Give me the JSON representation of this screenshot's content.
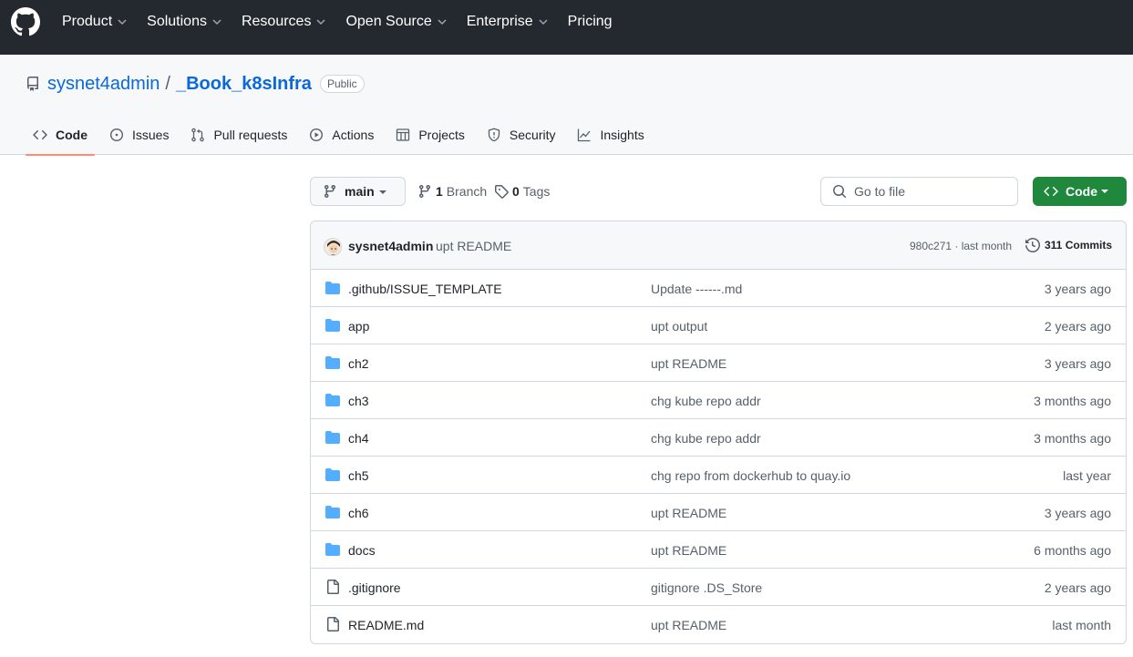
{
  "nav": {
    "items": [
      {
        "label": "Product",
        "dropdown": true
      },
      {
        "label": "Solutions",
        "dropdown": true
      },
      {
        "label": "Resources",
        "dropdown": true
      },
      {
        "label": "Open Source",
        "dropdown": true
      },
      {
        "label": "Enterprise",
        "dropdown": true
      },
      {
        "label": "Pricing",
        "dropdown": false
      }
    ]
  },
  "repo": {
    "owner": "sysnet4admin",
    "separator": "/",
    "name": "_Book_k8sInfra",
    "visibility": "Public"
  },
  "tabs": [
    {
      "label": "Code",
      "icon": "code-icon",
      "active": true
    },
    {
      "label": "Issues",
      "icon": "issue-icon",
      "active": false
    },
    {
      "label": "Pull requests",
      "icon": "pull-request-icon",
      "active": false
    },
    {
      "label": "Actions",
      "icon": "play-icon",
      "active": false
    },
    {
      "label": "Projects",
      "icon": "table-icon",
      "active": false
    },
    {
      "label": "Security",
      "icon": "shield-icon",
      "active": false
    },
    {
      "label": "Insights",
      "icon": "graph-icon",
      "active": false
    }
  ],
  "toolbar": {
    "branch": "main",
    "branch_count": "1",
    "branch_label": "Branch",
    "tag_count": "0",
    "tag_label": "Tags",
    "goto_placeholder": "Go to file",
    "code_label": "Code"
  },
  "latest_commit": {
    "author": "sysnet4admin",
    "message": "upt README",
    "sha_time": "980c271 · last month",
    "commits": "311 Commits"
  },
  "files": [
    {
      "type": "folder",
      "name": ".github/ISSUE_TEMPLATE",
      "message": "Update ------.md",
      "time": "3 years ago"
    },
    {
      "type": "folder",
      "name": "app",
      "message": "upt output",
      "time": "2 years ago"
    },
    {
      "type": "folder",
      "name": "ch2",
      "message": "upt README",
      "time": "3 years ago"
    },
    {
      "type": "folder",
      "name": "ch3",
      "message": "chg kube repo addr",
      "time": "3 months ago"
    },
    {
      "type": "folder",
      "name": "ch4",
      "message": "chg kube repo addr",
      "time": "3 months ago"
    },
    {
      "type": "folder",
      "name": "ch5",
      "message": "chg repo from dockerhub to quay.io",
      "time": "last year"
    },
    {
      "type": "folder",
      "name": "ch6",
      "message": "upt README",
      "time": "3 years ago"
    },
    {
      "type": "folder",
      "name": "docs",
      "message": "upt README",
      "time": "6 months ago"
    },
    {
      "type": "file",
      "name": ".gitignore",
      "message": "gitignore .DS_Store",
      "time": "2 years ago"
    },
    {
      "type": "file",
      "name": "README.md",
      "message": "upt README",
      "time": "last month"
    }
  ],
  "colors": {
    "nav_bg": "#24292f",
    "link": "#0969da",
    "tab_underline": "#fd8c73",
    "folder": "#54aeff",
    "code_button": "#1f883d"
  }
}
